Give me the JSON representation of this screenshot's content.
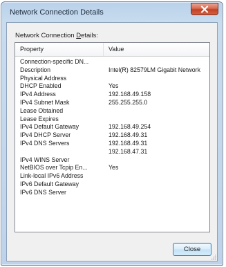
{
  "window": {
    "title": "Network Connection Details",
    "close_icon": "close-icon",
    "accent": "#c24127"
  },
  "group_label": "Network Connection Details:",
  "table": {
    "columns": [
      "Property",
      "Value"
    ],
    "rows": [
      {
        "property": "Connection-specific DN...",
        "value": ""
      },
      {
        "property": "Description",
        "value": "Intel(R) 82579LM Gigabit Network"
      },
      {
        "property": "Physical Address",
        "value": ""
      },
      {
        "property": "DHCP Enabled",
        "value": "Yes"
      },
      {
        "property": "IPv4 Address",
        "value": "192.168.49.158"
      },
      {
        "property": "IPv4 Subnet Mask",
        "value": "255.255.255.0"
      },
      {
        "property": "Lease Obtained",
        "value": ""
      },
      {
        "property": "Lease Expires",
        "value": ""
      },
      {
        "property": "IPv4 Default Gateway",
        "value": "192.168.49.254"
      },
      {
        "property": "IPv4 DHCP Server",
        "value": "192.168.49.31"
      },
      {
        "property": "IPv4 DNS Servers",
        "value": "192.168.49.31"
      },
      {
        "property": "",
        "value": "192.168.47.31"
      },
      {
        "property": "IPv4 WINS Server",
        "value": ""
      },
      {
        "property": "NetBIOS over Tcpip En...",
        "value": "Yes"
      },
      {
        "property": "Link-local IPv6 Address",
        "value": ""
      },
      {
        "property": "IPv6 Default Gateway",
        "value": ""
      },
      {
        "property": "IPv6 DNS Server",
        "value": ""
      }
    ]
  },
  "buttons": {
    "close_label": "Close"
  }
}
